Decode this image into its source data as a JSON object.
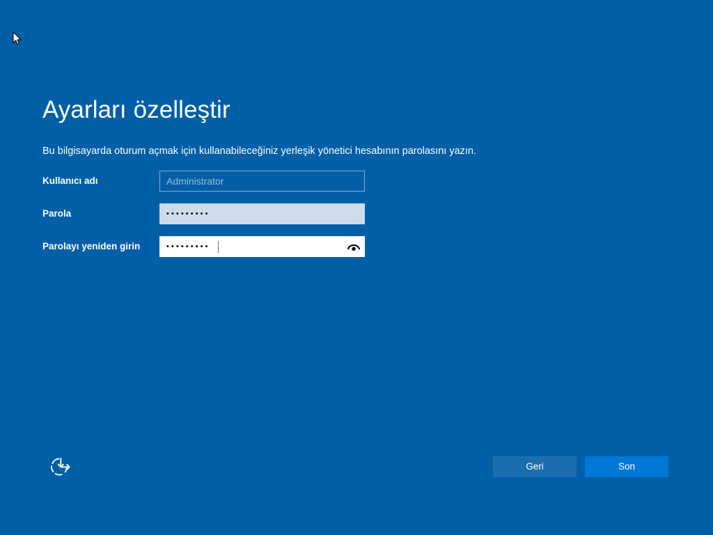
{
  "window": {
    "background_color": "#005fa6",
    "accent_color": "#0078d7"
  },
  "header": {
    "title": "Ayarları özelleştir",
    "subtitle": "Bu bilgisayarda oturum açmak için kullanabileceğiniz yerleşik yönetici hesabının parolasını yazın."
  },
  "form": {
    "fields": [
      {
        "label": "Kullanıcı adı",
        "placeholder": "Administrator",
        "value": "",
        "type": "text",
        "state": "empty"
      },
      {
        "label": "Parola",
        "placeholder": "",
        "value": "•••••••••",
        "type": "password",
        "state": "filled"
      },
      {
        "label": "Parolayı yeniden girin",
        "placeholder": "",
        "value": "•••••••••",
        "type": "password",
        "state": "focused",
        "reveal_icon": "eye-icon"
      }
    ]
  },
  "footer": {
    "ease_of_access_icon": "ease-of-access-icon",
    "back_label": "Geri",
    "finish_label": "Son"
  },
  "pointer": {
    "icon": "mouse-arrow-cursor"
  }
}
